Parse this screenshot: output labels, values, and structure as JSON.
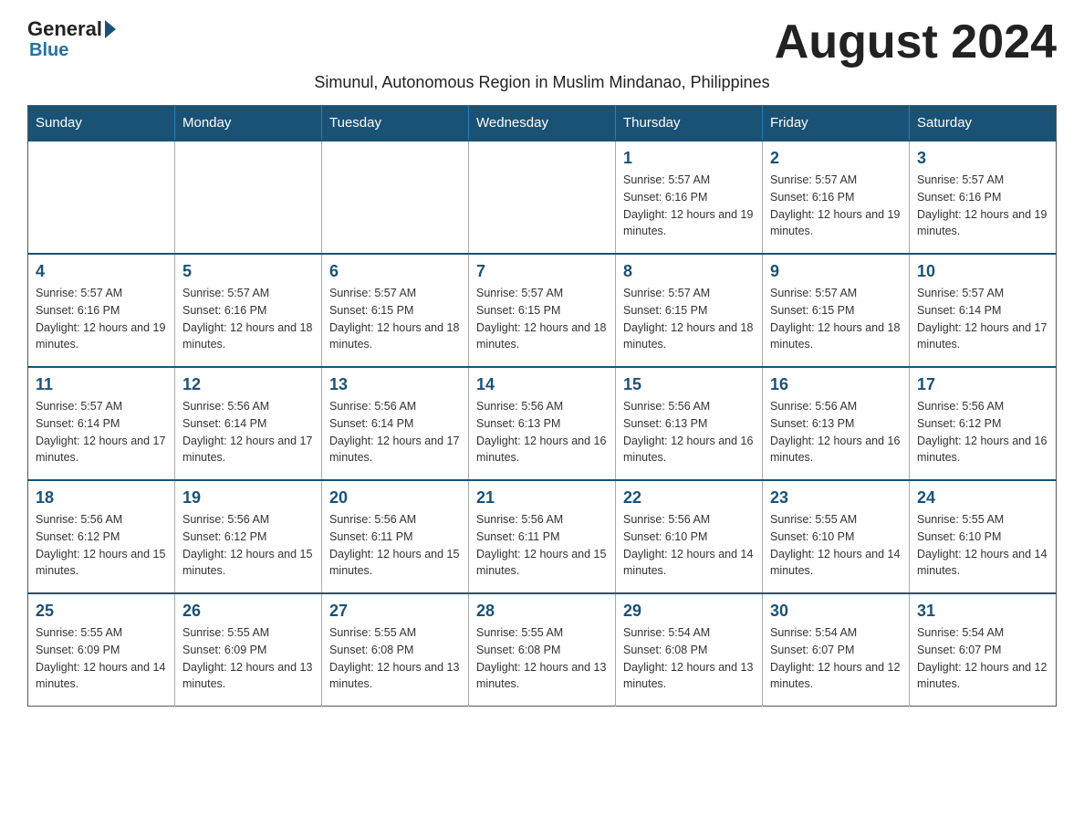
{
  "logo": {
    "general": "General",
    "blue": "Blue"
  },
  "title": "August 2024",
  "subtitle": "Simunul, Autonomous Region in Muslim Mindanao, Philippines",
  "days_of_week": [
    "Sunday",
    "Monday",
    "Tuesday",
    "Wednesday",
    "Thursday",
    "Friday",
    "Saturday"
  ],
  "weeks": [
    [
      {
        "day": "",
        "info": ""
      },
      {
        "day": "",
        "info": ""
      },
      {
        "day": "",
        "info": ""
      },
      {
        "day": "",
        "info": ""
      },
      {
        "day": "1",
        "info": "Sunrise: 5:57 AM\nSunset: 6:16 PM\nDaylight: 12 hours and 19 minutes."
      },
      {
        "day": "2",
        "info": "Sunrise: 5:57 AM\nSunset: 6:16 PM\nDaylight: 12 hours and 19 minutes."
      },
      {
        "day": "3",
        "info": "Sunrise: 5:57 AM\nSunset: 6:16 PM\nDaylight: 12 hours and 19 minutes."
      }
    ],
    [
      {
        "day": "4",
        "info": "Sunrise: 5:57 AM\nSunset: 6:16 PM\nDaylight: 12 hours and 19 minutes."
      },
      {
        "day": "5",
        "info": "Sunrise: 5:57 AM\nSunset: 6:16 PM\nDaylight: 12 hours and 18 minutes."
      },
      {
        "day": "6",
        "info": "Sunrise: 5:57 AM\nSunset: 6:15 PM\nDaylight: 12 hours and 18 minutes."
      },
      {
        "day": "7",
        "info": "Sunrise: 5:57 AM\nSunset: 6:15 PM\nDaylight: 12 hours and 18 minutes."
      },
      {
        "day": "8",
        "info": "Sunrise: 5:57 AM\nSunset: 6:15 PM\nDaylight: 12 hours and 18 minutes."
      },
      {
        "day": "9",
        "info": "Sunrise: 5:57 AM\nSunset: 6:15 PM\nDaylight: 12 hours and 18 minutes."
      },
      {
        "day": "10",
        "info": "Sunrise: 5:57 AM\nSunset: 6:14 PM\nDaylight: 12 hours and 17 minutes."
      }
    ],
    [
      {
        "day": "11",
        "info": "Sunrise: 5:57 AM\nSunset: 6:14 PM\nDaylight: 12 hours and 17 minutes."
      },
      {
        "day": "12",
        "info": "Sunrise: 5:56 AM\nSunset: 6:14 PM\nDaylight: 12 hours and 17 minutes."
      },
      {
        "day": "13",
        "info": "Sunrise: 5:56 AM\nSunset: 6:14 PM\nDaylight: 12 hours and 17 minutes."
      },
      {
        "day": "14",
        "info": "Sunrise: 5:56 AM\nSunset: 6:13 PM\nDaylight: 12 hours and 16 minutes."
      },
      {
        "day": "15",
        "info": "Sunrise: 5:56 AM\nSunset: 6:13 PM\nDaylight: 12 hours and 16 minutes."
      },
      {
        "day": "16",
        "info": "Sunrise: 5:56 AM\nSunset: 6:13 PM\nDaylight: 12 hours and 16 minutes."
      },
      {
        "day": "17",
        "info": "Sunrise: 5:56 AM\nSunset: 6:12 PM\nDaylight: 12 hours and 16 minutes."
      }
    ],
    [
      {
        "day": "18",
        "info": "Sunrise: 5:56 AM\nSunset: 6:12 PM\nDaylight: 12 hours and 15 minutes."
      },
      {
        "day": "19",
        "info": "Sunrise: 5:56 AM\nSunset: 6:12 PM\nDaylight: 12 hours and 15 minutes."
      },
      {
        "day": "20",
        "info": "Sunrise: 5:56 AM\nSunset: 6:11 PM\nDaylight: 12 hours and 15 minutes."
      },
      {
        "day": "21",
        "info": "Sunrise: 5:56 AM\nSunset: 6:11 PM\nDaylight: 12 hours and 15 minutes."
      },
      {
        "day": "22",
        "info": "Sunrise: 5:56 AM\nSunset: 6:10 PM\nDaylight: 12 hours and 14 minutes."
      },
      {
        "day": "23",
        "info": "Sunrise: 5:55 AM\nSunset: 6:10 PM\nDaylight: 12 hours and 14 minutes."
      },
      {
        "day": "24",
        "info": "Sunrise: 5:55 AM\nSunset: 6:10 PM\nDaylight: 12 hours and 14 minutes."
      }
    ],
    [
      {
        "day": "25",
        "info": "Sunrise: 5:55 AM\nSunset: 6:09 PM\nDaylight: 12 hours and 14 minutes."
      },
      {
        "day": "26",
        "info": "Sunrise: 5:55 AM\nSunset: 6:09 PM\nDaylight: 12 hours and 13 minutes."
      },
      {
        "day": "27",
        "info": "Sunrise: 5:55 AM\nSunset: 6:08 PM\nDaylight: 12 hours and 13 minutes."
      },
      {
        "day": "28",
        "info": "Sunrise: 5:55 AM\nSunset: 6:08 PM\nDaylight: 12 hours and 13 minutes."
      },
      {
        "day": "29",
        "info": "Sunrise: 5:54 AM\nSunset: 6:08 PM\nDaylight: 12 hours and 13 minutes."
      },
      {
        "day": "30",
        "info": "Sunrise: 5:54 AM\nSunset: 6:07 PM\nDaylight: 12 hours and 12 minutes."
      },
      {
        "day": "31",
        "info": "Sunrise: 5:54 AM\nSunset: 6:07 PM\nDaylight: 12 hours and 12 minutes."
      }
    ]
  ]
}
